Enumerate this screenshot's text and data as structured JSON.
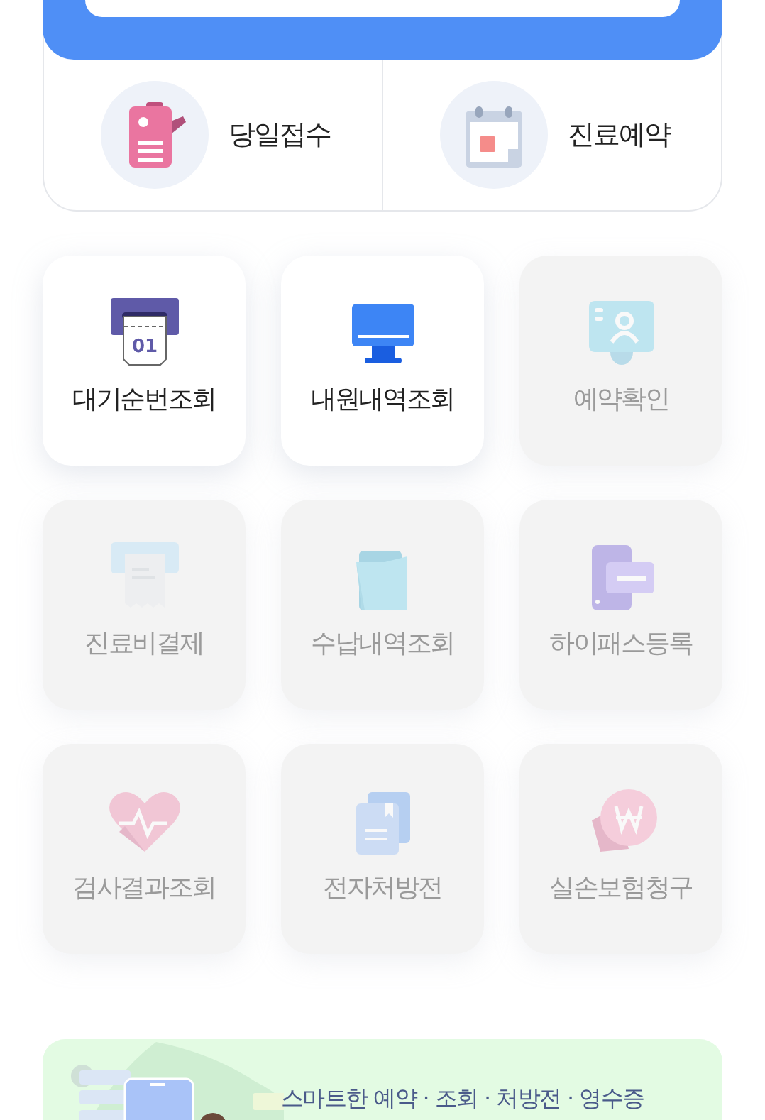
{
  "quick_actions": [
    {
      "label": "당일접수"
    },
    {
      "label": "진료예약"
    }
  ],
  "menu_tiles": [
    {
      "label": "대기순번조회",
      "disabled": false,
      "icon_text": "01"
    },
    {
      "label": "내원내역조회",
      "disabled": false
    },
    {
      "label": "예약확인",
      "disabled": true
    },
    {
      "label": "진료비결제",
      "disabled": true
    },
    {
      "label": "수납내역조회",
      "disabled": true
    },
    {
      "label": "하이패스등록",
      "disabled": true
    },
    {
      "label": "검사결과조회",
      "disabled": true
    },
    {
      "label": "전자처방전",
      "disabled": true
    },
    {
      "label": "실손보험청구",
      "disabled": true
    }
  ],
  "banner": {
    "title": "스마트한 예약 · 조회 · 처방전 · 영수증"
  }
}
